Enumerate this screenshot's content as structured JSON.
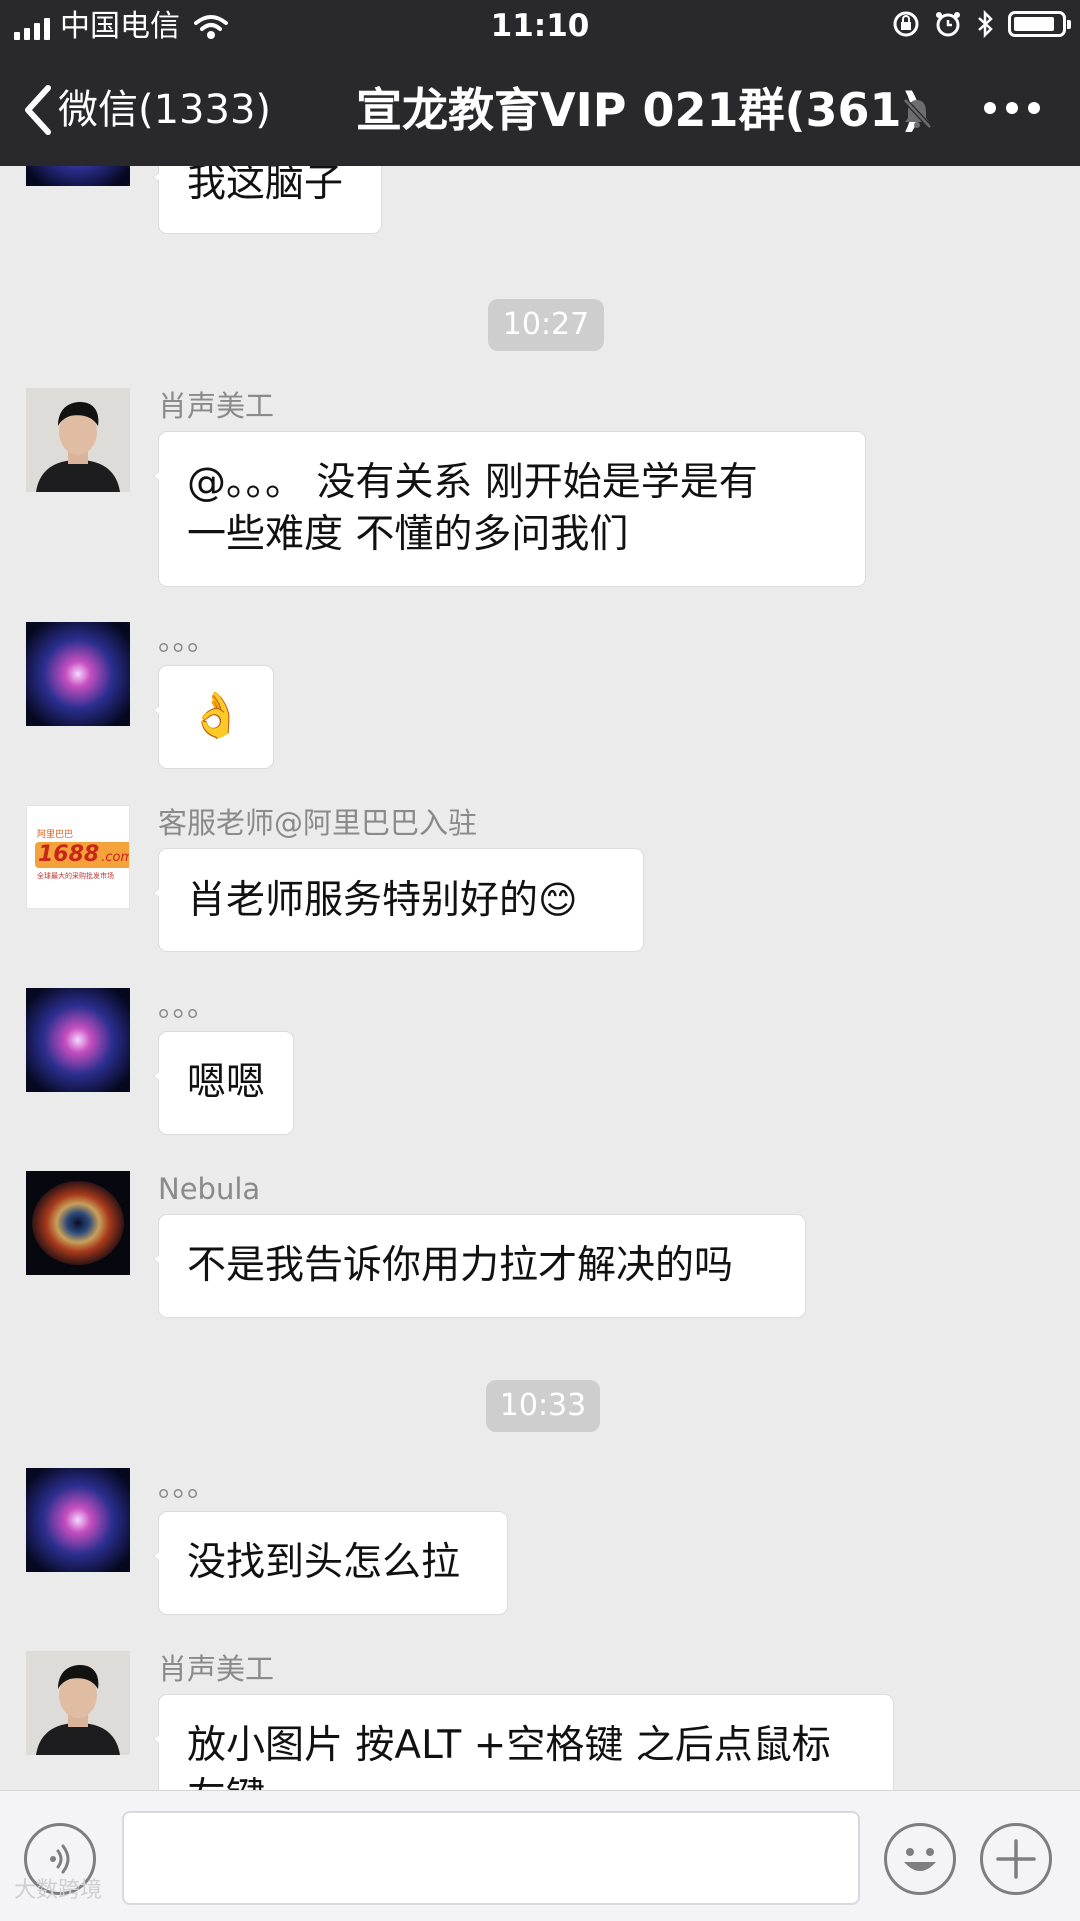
{
  "status_bar": {
    "carrier": "中国电信",
    "time": "11:10"
  },
  "nav": {
    "back_label": "微信(1333)",
    "title": "宣龙教育VIP 021群(361)"
  },
  "messages": [
    {
      "type": "text",
      "sender": "",
      "text": "我这脑子",
      "avatar": "galaxy-avatar"
    },
    {
      "type": "time",
      "text": "10:27"
    },
    {
      "type": "text",
      "sender": "肖声美工",
      "lines": [
        "@。。。 没有关系 刚开始是学是有",
        "一些难度 不懂的多问我们"
      ],
      "avatar": "man-portrait-avatar"
    },
    {
      "type": "emoji",
      "sender": "。。。",
      "emoji": "👌",
      "avatar": "galaxy-avatar"
    },
    {
      "type": "text",
      "sender": "客服老师@阿里巴巴入驻",
      "text": "肖老师服务特别好的",
      "emoji": "😊",
      "avatar": "1688-logo-avatar"
    },
    {
      "type": "text",
      "sender": "。。。",
      "text": "嗯嗯",
      "avatar": "galaxy-avatar"
    },
    {
      "type": "text",
      "sender": "Nebula",
      "text": "不是我告诉你用力拉才解决的吗",
      "avatar": "nebula-avatar"
    },
    {
      "type": "time",
      "text": "10:33"
    },
    {
      "type": "text",
      "sender": "。。。",
      "text": "没找到头怎么拉",
      "avatar": "galaxy-avatar"
    },
    {
      "type": "text",
      "sender": "肖声美工",
      "lines": [
        "放小图片 按ALT +空格键 之后点鼠标",
        "左键"
      ],
      "avatar": "man-portrait-avatar"
    }
  ],
  "avatar_logo": {
    "top": "阿里巴巴",
    "main": "1688",
    "suffix": ".com",
    "tagline": "全球最大的采购批发市场"
  },
  "watermark": "大数跨境",
  "colors": {
    "nav_background": "#29292b",
    "chat_background": "#ebebeb",
    "bubble": "#ffffff",
    "time_badge": "#cecece"
  }
}
